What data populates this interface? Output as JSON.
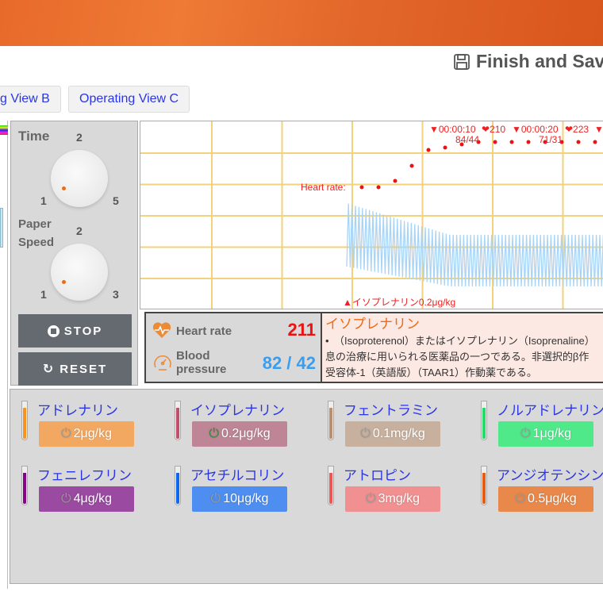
{
  "header": {
    "save_label": "Finish and Sav"
  },
  "tabs": [
    {
      "label": "g View B"
    },
    {
      "label": "Operating View C"
    }
  ],
  "controls": {
    "time": {
      "label": "Time",
      "min": "1",
      "mid": "2",
      "max": "5"
    },
    "paper_speed": {
      "label_line1": "Paper",
      "label_line2": "Speed",
      "min": "1",
      "mid": "2",
      "max": "3"
    },
    "stop_label": "STOP",
    "reset_label": "RESET"
  },
  "chart": {
    "heart_rate_label": "Heart rate:",
    "markers": [
      {
        "text": "▼00:00:10"
      },
      {
        "text": "❤210"
      },
      {
        "text": "▼00:00:20"
      },
      {
        "text": "❤223"
      },
      {
        "text": "▼0"
      }
    ],
    "bp_labels": [
      {
        "text": "84/44"
      },
      {
        "text": "71/31"
      }
    ],
    "drug_event": "▲イソプレナリン0.2μg/kg",
    "colors": {
      "grid": "#f2d27a",
      "dots": "#ee1111",
      "wave": "#a9d4f5"
    }
  },
  "vitals": {
    "heart_rate_label": "Heart rate",
    "heart_rate_value": "211",
    "bp_label_line1": "Blood",
    "bp_label_line2": "pressure",
    "bp_value": "82 / 42"
  },
  "description": {
    "title": "イソプレナリン",
    "lines": [
      "•　（Isoproterenol）またはイソプレナリン（Isoprenaline）",
      "息の治療に用いられる医薬品の一つである。非選択的β作",
      "受容体-1（英語版）（TAAR1）作動薬である。"
    ]
  },
  "drugs": [
    {
      "name": "アドレナリン",
      "dose": "2μg/kg",
      "color": "#f3a862",
      "tube": "#f7931e",
      "active": false
    },
    {
      "name": "イソプレナリン",
      "dose": "0.2μg/kg",
      "color": "#bd8595",
      "tube": "#c0506a",
      "active": true
    },
    {
      "name": "フェントラミン",
      "dose": "0.1mg/kg",
      "color": "#c8b09e",
      "tube": "#b89070",
      "active": false
    },
    {
      "name": "ノルアドレナリン",
      "dose": "1μg/kg",
      "color": "#4fe98a",
      "tube": "#22dd66",
      "active": false
    },
    {
      "name": "フェニレフリン",
      "dose": "4μg/kg",
      "color": "#9a4aa0",
      "tube": "#880088",
      "active": false
    },
    {
      "name": "アセチルコリン",
      "dose": "10μg/kg",
      "color": "#4e8ef0",
      "tube": "#1166ee",
      "active": false
    },
    {
      "name": "アトロピン",
      "dose": "3mg/kg",
      "color": "#f09090",
      "tube": "#ee5555",
      "active": false
    },
    {
      "name": "アンジオテンシン",
      "dose": "0.5μg/kg",
      "color": "#e8884a",
      "tube": "#e65c10",
      "active": false
    }
  ]
}
